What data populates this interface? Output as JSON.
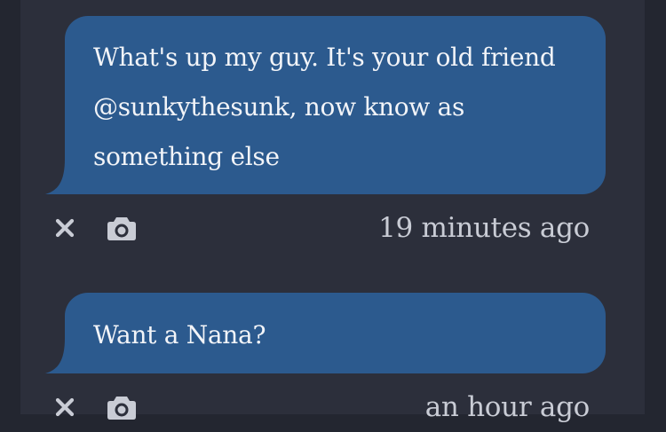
{
  "messages": [
    {
      "text": "What's up my guy. It's your old friend @sunkythesunk, now know as something else",
      "timestamp": "19 minutes ago"
    },
    {
      "text": "Want a Nana?",
      "timestamp": "an hour ago"
    }
  ],
  "icons": {
    "dismiss": "close-icon",
    "screenshot": "camera-icon"
  },
  "colors": {
    "background": "#232630",
    "panel": "#2c2f3b",
    "bubble": "#2c5a8e",
    "bubble_text": "#f2f4f8",
    "meta_text": "#c9ccd5"
  }
}
